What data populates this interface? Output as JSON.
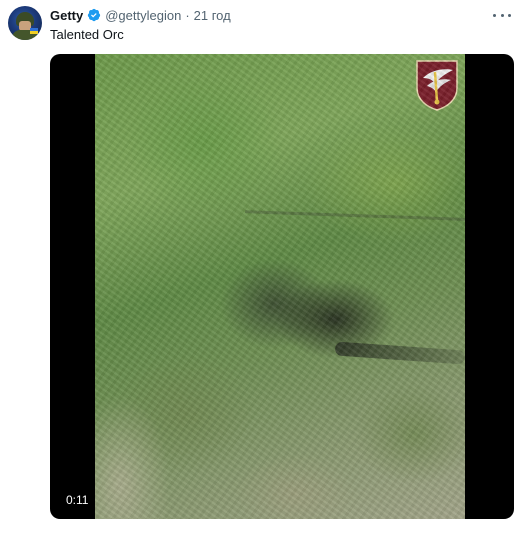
{
  "tweet": {
    "author_name": "Getty",
    "handle": "@gettylegion",
    "separator": "·",
    "time": "21 год",
    "text": "Talented Orc"
  },
  "media": {
    "duration": "0:11"
  },
  "colors": {
    "verified": "#1d9bf0",
    "secondary_text": "#536471",
    "primary_text": "#0f1419",
    "emblem_maroon": "#7a1f2a"
  },
  "icons": {
    "verified": "verified-badge-icon",
    "more": "more-options-icon",
    "emblem": "unit-emblem"
  }
}
